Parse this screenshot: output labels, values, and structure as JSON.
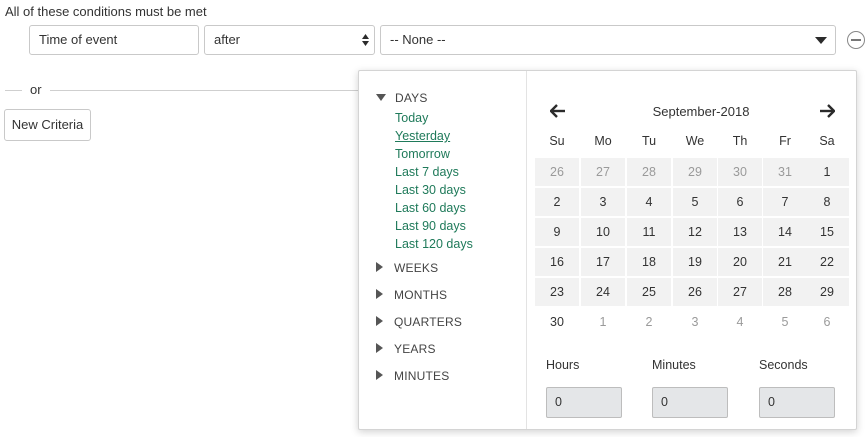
{
  "condition_heading": "All of these conditions must be met",
  "field": {
    "value": "Time of event"
  },
  "operator": {
    "value": "after"
  },
  "value_select": {
    "value": "-- None --"
  },
  "or_label": "or",
  "new_criteria_label": "New Criteria",
  "icons": {
    "remove": "minus-circle-icon",
    "prev": "arrow-left-icon",
    "next": "arrow-right-icon",
    "expand": "triangle-right-icon",
    "collapse": "triangle-down-icon",
    "dropdown": "caret-down-icon"
  },
  "colors": {
    "link": "#1f7a5a",
    "cell_bg": "#f2f2f2",
    "input_bg": "#e4e6e8"
  },
  "ranges": {
    "days_header": "DAYS",
    "days": [
      "Today",
      "Yesterday",
      "Tomorrow",
      "Last 7 days",
      "Last 30 days",
      "Last 60 days",
      "Last 90 days",
      "Last 120 days"
    ],
    "selected_day": "Yesterday",
    "collapsed": [
      "WEEKS",
      "MONTHS",
      "QUARTERS",
      "YEARS",
      "MINUTES"
    ]
  },
  "calendar": {
    "month_label": "September-2018",
    "weekdays": [
      "Su",
      "Mo",
      "Tu",
      "We",
      "Th",
      "Fr",
      "Sa"
    ],
    "weeks": [
      [
        "26",
        "27",
        "28",
        "29",
        "30",
        "31",
        "1"
      ],
      [
        "2",
        "3",
        "4",
        "5",
        "6",
        "7",
        "8"
      ],
      [
        "9",
        "10",
        "11",
        "12",
        "13",
        "14",
        "15"
      ],
      [
        "16",
        "17",
        "18",
        "19",
        "20",
        "21",
        "22"
      ],
      [
        "23",
        "24",
        "25",
        "26",
        "27",
        "28",
        "29"
      ],
      [
        "30",
        "1",
        "2",
        "3",
        "4",
        "5",
        "6"
      ]
    ],
    "time": {
      "hours_label": "Hours",
      "hours_value": "0",
      "minutes_label": "Minutes",
      "minutes_value": "0",
      "seconds_label": "Seconds",
      "seconds_value": "0"
    }
  }
}
